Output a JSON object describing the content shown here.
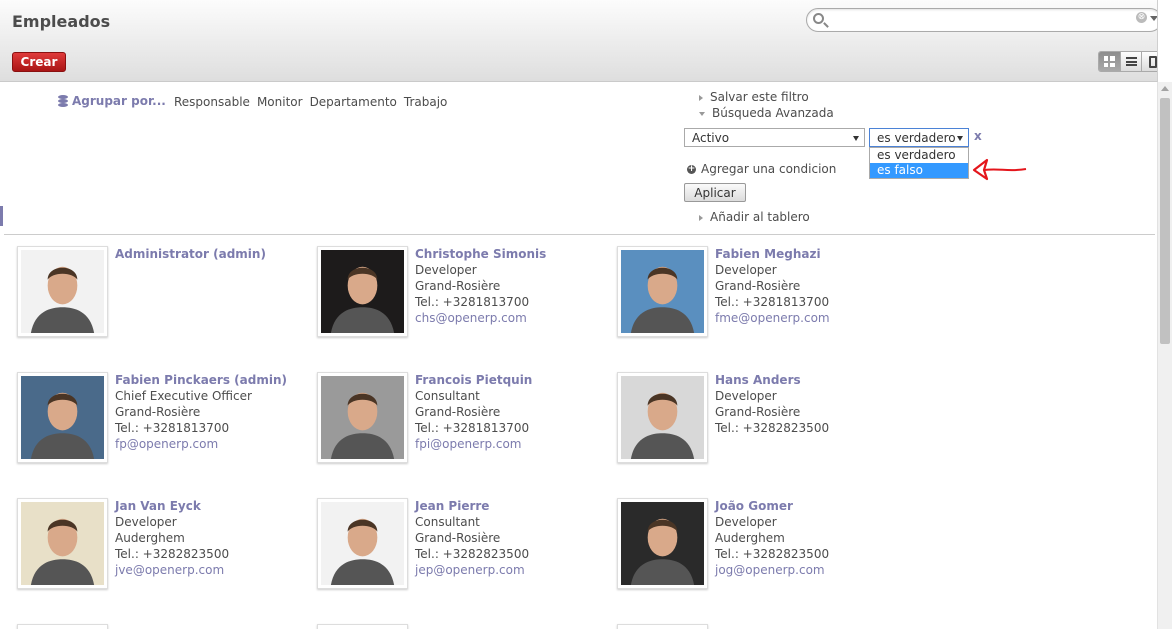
{
  "header": {
    "title": "Empleados",
    "search_placeholder": "",
    "search_clear": "⊗",
    "create_label": "Crear"
  },
  "filters": {
    "group_by_label": "Agrupar por...",
    "group_by_options": [
      "Responsable",
      "Monitor",
      "Departamento",
      "Trabajo"
    ],
    "save_filter": "Salvar este filtro",
    "advanced_search": "Búsqueda Avanzada",
    "field_value": "Activo",
    "operator_value": "es verdadero",
    "remove": "x",
    "operator_options": [
      "es verdadero",
      "es falso"
    ],
    "highlighted_option": "es falso",
    "add_condition": "Agregar una condicion",
    "apply": "Aplicar",
    "add_to_dashboard": "Añadir al tablero"
  },
  "employees": [
    {
      "name": "Administrator (admin)",
      "job": "",
      "location": "",
      "phone": "",
      "email": "",
      "photo": "#f2f2f2"
    },
    {
      "name": "Christophe Simonis",
      "job": "Developer",
      "location": "Grand-Rosière",
      "phone": "Tel.: +3281813700",
      "email": "chs@openerp.com",
      "photo": "#1d1b1b"
    },
    {
      "name": "Fabien Meghazi",
      "job": "Developer",
      "location": "Grand-Rosière",
      "phone": "Tel.: +3281813700",
      "email": "fme@openerp.com",
      "photo": "#5a8fbf"
    },
    {
      "name": "Fabien Pinckaers (admin)",
      "job": "Chief Executive Officer",
      "location": "Grand-Rosière",
      "phone": "Tel.: +3281813700",
      "email": "fp@openerp.com",
      "photo": "#4a6a8a"
    },
    {
      "name": "Francois Pietquin",
      "job": "Consultant",
      "location": "Grand-Rosière",
      "phone": "Tel.: +3281813700",
      "email": "fpi@openerp.com",
      "photo": "#9a9a9a"
    },
    {
      "name": "Hans Anders",
      "job": "Developer",
      "location": "Grand-Rosière",
      "phone": "Tel.: +3282823500",
      "email": "",
      "photo": "#d8d8d8"
    },
    {
      "name": "Jan Van Eyck",
      "job": "Developer",
      "location": "Auderghem",
      "phone": "Tel.: +3282823500",
      "email": "jve@openerp.com",
      "photo": "#e8e0c8"
    },
    {
      "name": "Jean Pierre",
      "job": "Consultant",
      "location": "Grand-Rosière",
      "phone": "Tel.: +3282823500",
      "email": "jep@openerp.com",
      "photo": "#f2f2f2"
    },
    {
      "name": "João Gomer",
      "job": "Developer",
      "location": "Auderghem",
      "phone": "Tel.: +3282823500",
      "email": "jog@openerp.com",
      "photo": "#2a2a2a"
    }
  ]
}
